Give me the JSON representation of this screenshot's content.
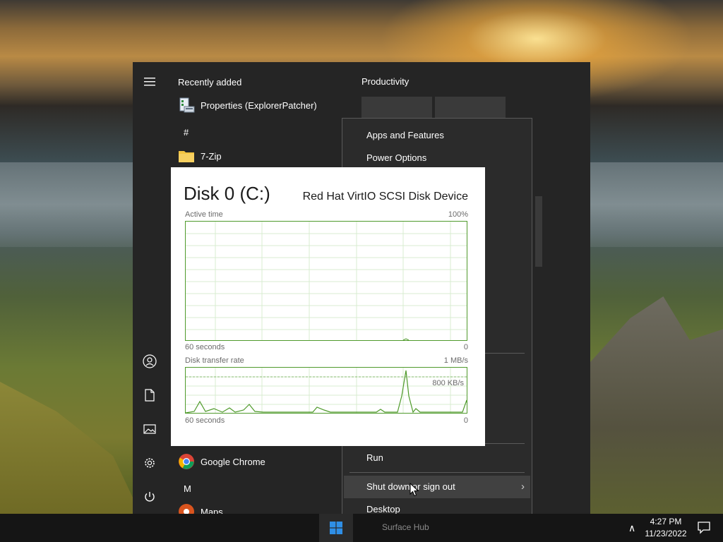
{
  "start_menu": {
    "recently_added_header": "Recently added",
    "recent_app": "Properties (ExplorerPatcher)",
    "letter_hash": "#",
    "app_7zip": "7-Zip",
    "app_chrome": "Google Chrome",
    "letter_m": "M",
    "app_maps": "Maps",
    "tiles_header": "Productivity"
  },
  "context_menu": {
    "items": [
      "Apps and Features",
      "Power Options",
      "Run",
      "Shut down or sign out",
      "Desktop"
    ]
  },
  "disk_card": {
    "title": "Disk 0 (C:)",
    "model": "Red Hat VirtIO SCSI Disk Device",
    "active_time_label": "Active time",
    "active_time_max": "100%",
    "active_time_xlabel": "60 seconds",
    "active_time_min": "0",
    "transfer_label": "Disk transfer rate",
    "transfer_max": "1 MB/s",
    "transfer_mid": "800 KB/s",
    "transfer_xlabel": "60 seconds",
    "transfer_min": "0",
    "accent_color": "#4f9a2b"
  },
  "taskbar": {
    "ghost_label": "Surface Hub",
    "time": "4:27 PM",
    "date": "11/23/2022"
  }
}
